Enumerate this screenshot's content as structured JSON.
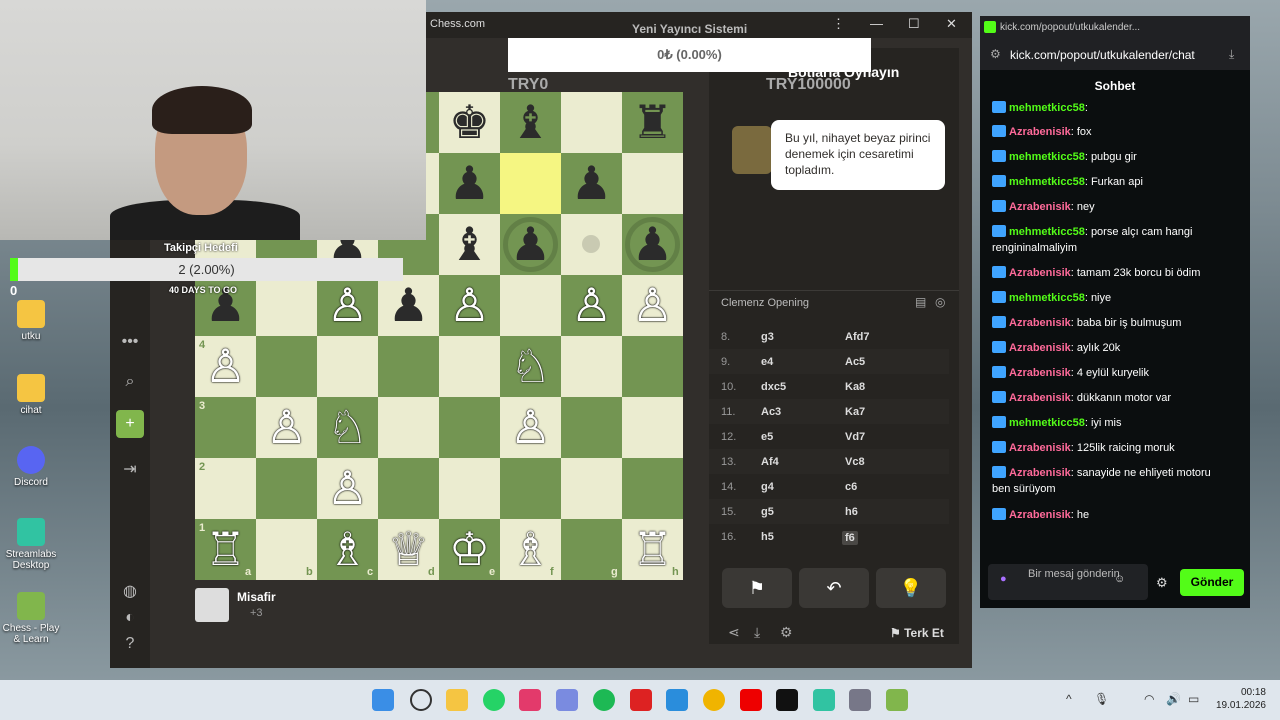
{
  "desktop": {
    "icons": [
      {
        "label": "utku"
      },
      {
        "label": "cihat"
      },
      {
        "label": "Discord"
      },
      {
        "label": "Streamlabs Desktop"
      },
      {
        "label": "Chess - Play & Learn"
      }
    ]
  },
  "chess_window": {
    "app_label": "Chess.com",
    "title": "Yeni Yayıncı Sistemi",
    "bot_name": "Botlarla Oynayın",
    "bot_message": "Bu yıl, nihayet beyaz pirinci denemek için cesaretimi topladım.",
    "opening": "Clemenz Opening",
    "moves": [
      {
        "n": "8.",
        "w": "g3",
        "b": "Afd7"
      },
      {
        "n": "9.",
        "w": "e4",
        "b": "Ac5"
      },
      {
        "n": "10.",
        "w": "dxc5",
        "b": "Ka8"
      },
      {
        "n": "11.",
        "w": "Ac3",
        "b": "Ka7"
      },
      {
        "n": "12.",
        "w": "e5",
        "b": "Vd7"
      },
      {
        "n": "13.",
        "w": "Af4",
        "b": "Vc8"
      },
      {
        "n": "14.",
        "w": "g4",
        "b": "c6"
      },
      {
        "n": "15.",
        "w": "g5",
        "b": "h6"
      },
      {
        "n": "16.",
        "w": "h5",
        "b": "f6"
      }
    ],
    "resign_label": "Terk Et",
    "player_name": "Misafir",
    "player_extra": "+3",
    "ranks": [
      "4",
      "3",
      "2",
      "1"
    ],
    "files": [
      "a",
      "b",
      "c",
      "d",
      "e",
      "f",
      "g",
      "h"
    ]
  },
  "overlay": {
    "goal_top_value": "0₺ (0.00%)",
    "goal_top_label": "TRY0",
    "goal_top_target": "TRY100000",
    "follow_label": "Takipçi Hedefi",
    "follow_value": "2 (2.00%)",
    "follow_percent": 2,
    "follow_days": "40 DAYS TO GO",
    "follow_zero": "0"
  },
  "kick": {
    "window_title": "kick.com/popout/utkukalender...",
    "url": "kick.com/popout/utkukalender/chat",
    "header": "Sohbet",
    "messages": [
      {
        "user": "mehmetkicc58",
        "type": "u1",
        "text": ""
      },
      {
        "user": "Azrabenisik",
        "type": "u2",
        "text": "fox"
      },
      {
        "user": "mehmetkicc58",
        "type": "u1",
        "text": "pubgu gir"
      },
      {
        "user": "mehmetkicc58",
        "type": "u1",
        "text": "Furkan api"
      },
      {
        "user": "Azrabenisik",
        "type": "u2",
        "text": "ney"
      },
      {
        "user": "mehmetkicc58",
        "type": "u1",
        "text": "porse alçı cam hangi rengininalmaliyim"
      },
      {
        "user": "Azrabenisik",
        "type": "u2",
        "text": "tamam 23k borcu bi ödim"
      },
      {
        "user": "mehmetkicc58",
        "type": "u1",
        "text": "niye"
      },
      {
        "user": "Azrabenisik",
        "type": "u2",
        "text": "baba bir iş bulmuşum"
      },
      {
        "user": "Azrabenisik",
        "type": "u2",
        "text": "aylık 20k"
      },
      {
        "user": "Azrabenisik",
        "type": "u2",
        "text": "4 eylül kuryelik"
      },
      {
        "user": "Azrabenisik",
        "type": "u2",
        "text": "dükkanın motor var"
      },
      {
        "user": "mehmetkicc58",
        "type": "u1",
        "text": "iyi mis"
      },
      {
        "user": "Azrabenisik",
        "type": "u2",
        "text": "125lik raicing moruk"
      },
      {
        "user": "Azrabenisik",
        "type": "u2",
        "text": "sanayide ne ehliyeti motoru ben sürüyom"
      },
      {
        "user": "Azrabenisik",
        "type": "u2",
        "text": "he"
      }
    ],
    "input_placeholder": "Bir mesaj gönderin",
    "send_label": "Gönder"
  },
  "taskbar": {
    "time": "00:18",
    "date": "19.01.2026"
  }
}
